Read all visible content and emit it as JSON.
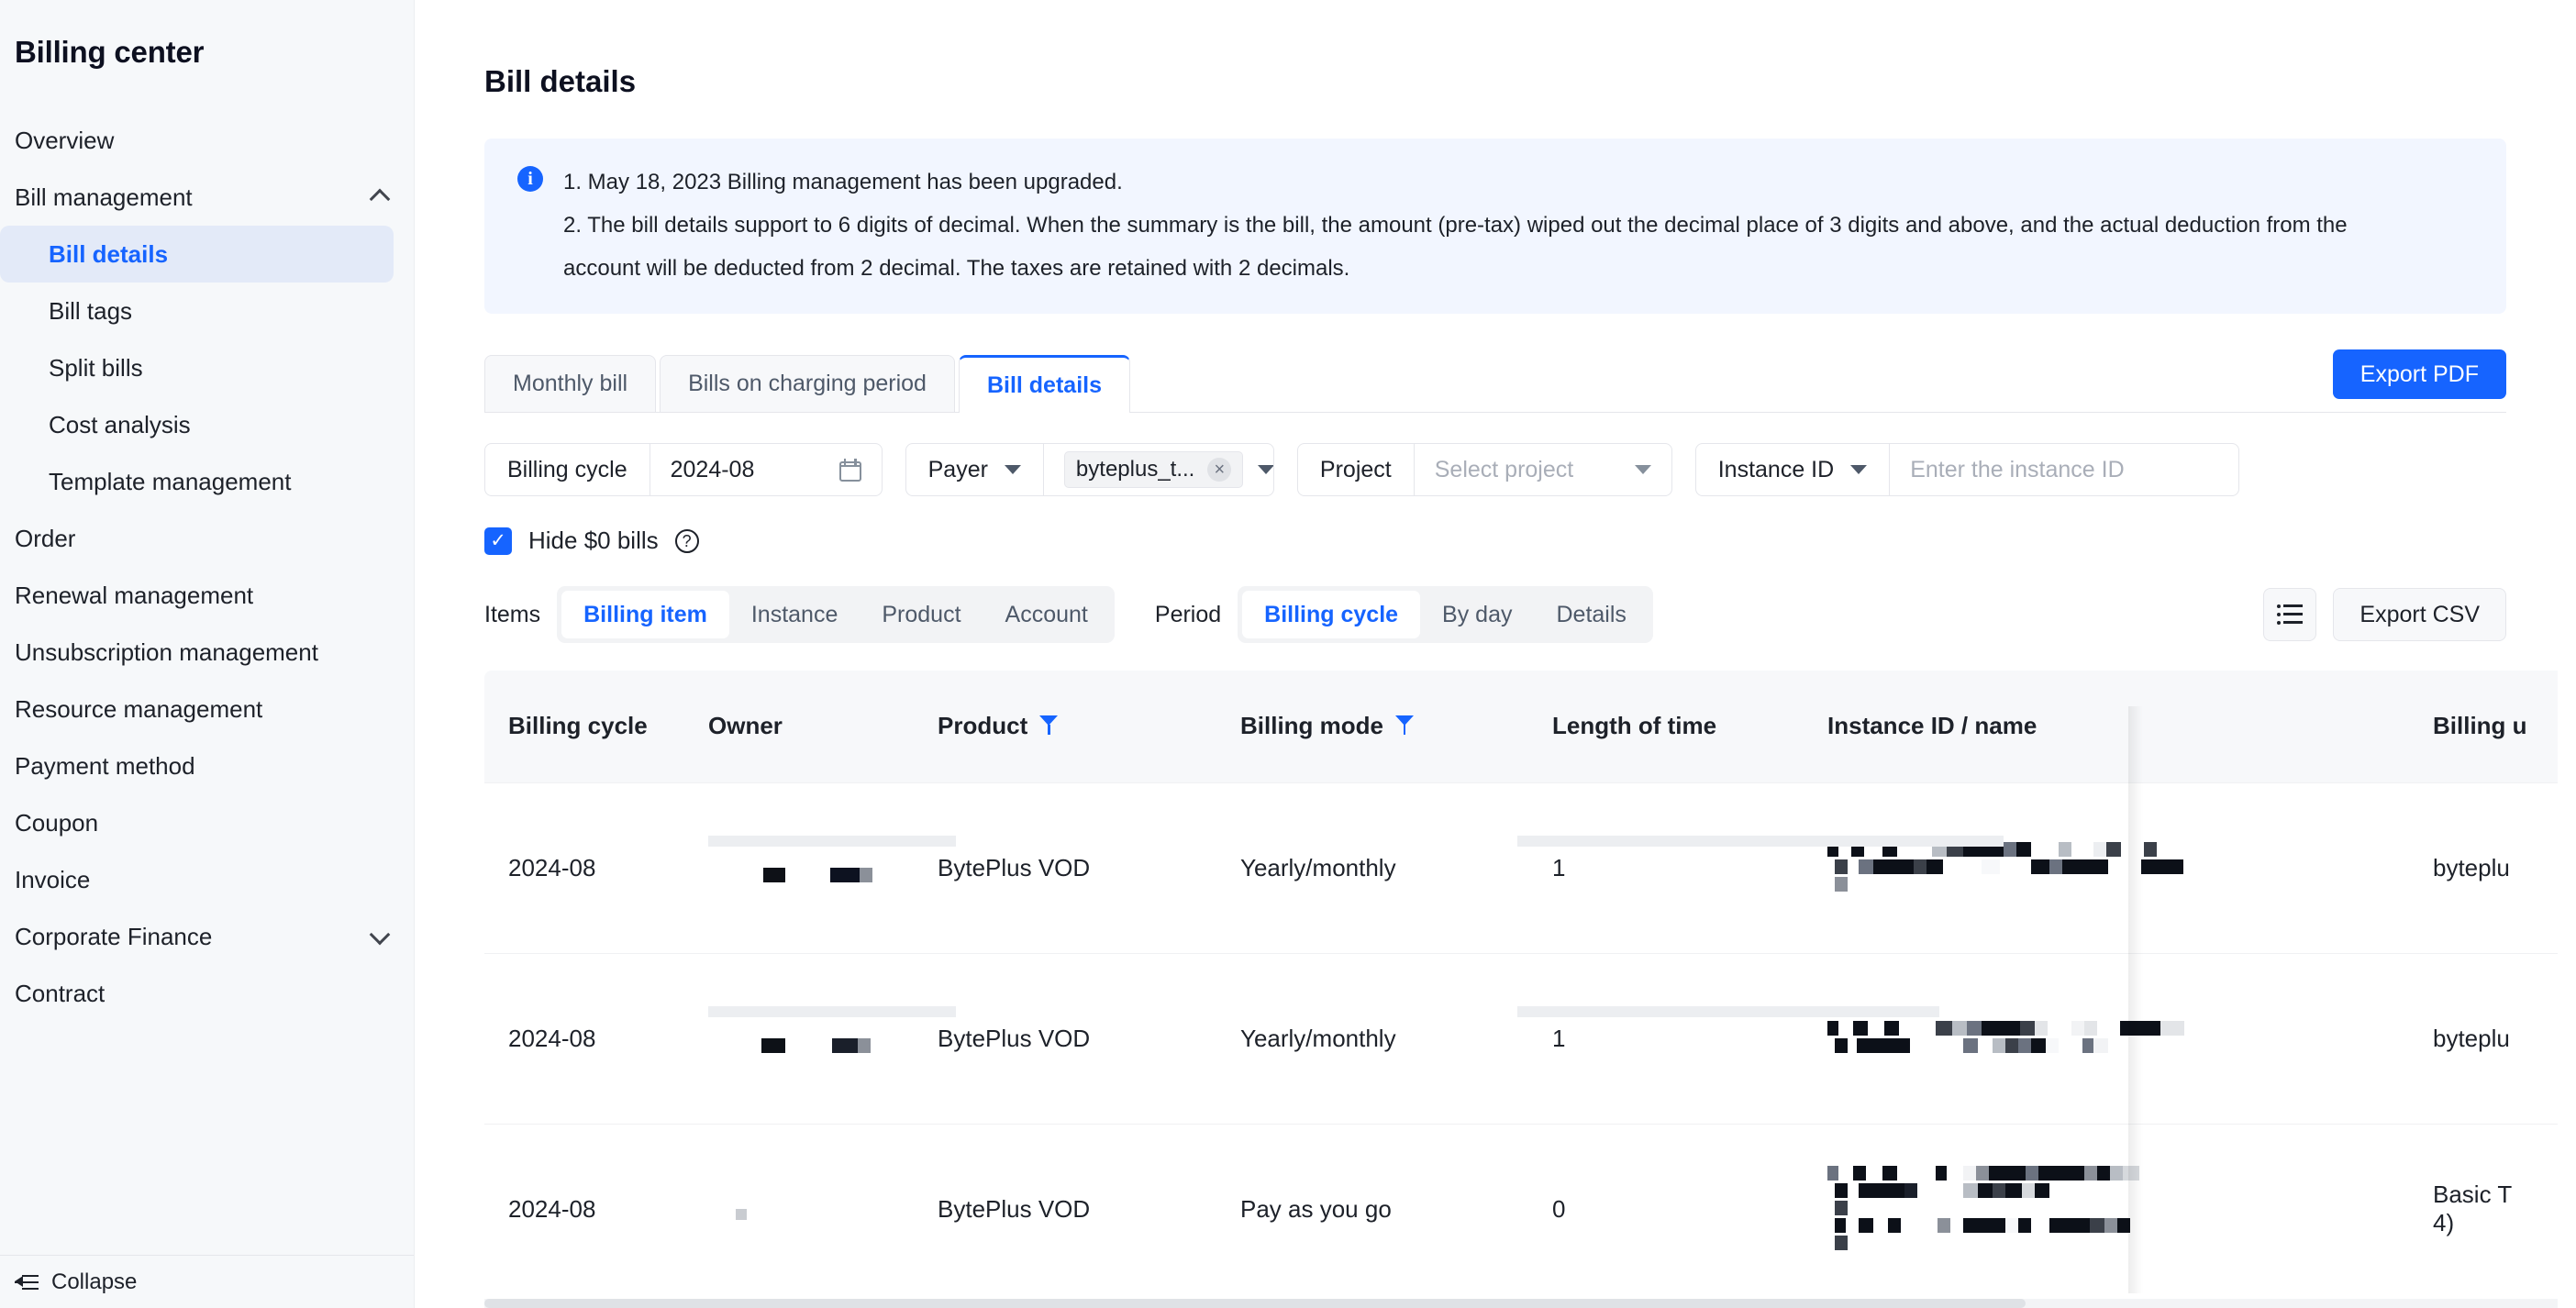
{
  "sidebar": {
    "title": "Billing center",
    "items": [
      {
        "label": "Overview",
        "type": "item"
      },
      {
        "label": "Bill management",
        "type": "group",
        "icon": "chevron-up-icon",
        "expanded": true
      },
      {
        "label": "Bill details",
        "type": "sub",
        "active": true
      },
      {
        "label": "Bill tags",
        "type": "sub"
      },
      {
        "label": "Split bills",
        "type": "sub"
      },
      {
        "label": "Cost analysis",
        "type": "sub"
      },
      {
        "label": "Template management",
        "type": "sub"
      },
      {
        "label": "Order",
        "type": "item"
      },
      {
        "label": "Renewal management",
        "type": "item"
      },
      {
        "label": "Unsubscription management",
        "type": "item"
      },
      {
        "label": "Resource management",
        "type": "item"
      },
      {
        "label": "Payment method",
        "type": "item"
      },
      {
        "label": "Coupon",
        "type": "item"
      },
      {
        "label": "Invoice",
        "type": "item"
      },
      {
        "label": "Corporate Finance",
        "type": "group",
        "icon": "chevron-down-icon",
        "expanded": false
      },
      {
        "label": "Contract",
        "type": "item"
      }
    ],
    "collapse_label": "Collapse"
  },
  "page": {
    "title": "Bill details"
  },
  "banner": {
    "icon": "info-icon",
    "line1": "1. May 18, 2023 Billing management has been upgraded.",
    "line2": "2. The bill details support to 6 digits of decimal. When the summary is the bill, the amount (pre-tax) wiped out the decimal place of 3 digits and above, and the actual deduction from the",
    "line3": "account will be deducted from 2 decimal. The taxes are retained with 2 decimals."
  },
  "tabs": [
    {
      "label": "Monthly bill",
      "active": false
    },
    {
      "label": "Bills on charging period",
      "active": false
    },
    {
      "label": "Bill details",
      "active": true
    }
  ],
  "toolbar": {
    "export_pdf_label": "Export PDF",
    "export_csv_label": "Export CSV",
    "list_view_icon": "list-icon"
  },
  "filters": {
    "billing_cycle": {
      "label": "Billing cycle",
      "value": "2024-08",
      "icon": "calendar-icon"
    },
    "payer": {
      "label": "Payer",
      "tag": "byteplus_t...",
      "remove_icon": "close-icon",
      "dropdown_icon": "chevron-down-icon"
    },
    "project": {
      "label": "Project",
      "placeholder": "Select project",
      "dropdown_icon": "chevron-down-icon"
    },
    "instance": {
      "label": "Instance ID",
      "placeholder": "Enter the instance ID",
      "dropdown_icon": "chevron-down-icon"
    },
    "hide_zero": {
      "label": "Hide $0 bills",
      "checked": true,
      "help_icon": "question-circle-icon"
    }
  },
  "segments": {
    "items_label": "Items",
    "items": [
      {
        "label": "Billing item",
        "active": true
      },
      {
        "label": "Instance",
        "active": false
      },
      {
        "label": "Product",
        "active": false
      },
      {
        "label": "Account",
        "active": false
      }
    ],
    "period_label": "Period",
    "period": [
      {
        "label": "Billing cycle",
        "active": true
      },
      {
        "label": "By day",
        "active": false
      },
      {
        "label": "Details",
        "active": false
      }
    ]
  },
  "table": {
    "columns": [
      {
        "label": "Billing cycle",
        "filter": false
      },
      {
        "label": "Owner",
        "filter": false
      },
      {
        "label": "Product",
        "filter": true
      },
      {
        "label": "Billing mode",
        "filter": true
      },
      {
        "label": "Length of time",
        "filter": false
      },
      {
        "label": "Instance ID / name",
        "filter": false
      },
      {
        "label": "Billing u",
        "filter": false
      }
    ],
    "rows": [
      {
        "billing_cycle": "2024-08",
        "owner": "[redacted]",
        "product": "BytePlus VOD",
        "billing_mode": "Yearly/monthly",
        "length_of_time": "1",
        "instance": "[redacted]",
        "billing_unit": "byteplu"
      },
      {
        "billing_cycle": "2024-08",
        "owner": "[redacted]",
        "product": "BytePlus VOD",
        "billing_mode": "Yearly/monthly",
        "length_of_time": "1",
        "instance": "[redacted]",
        "billing_unit": "byteplu"
      },
      {
        "billing_cycle": "2024-08",
        "owner": "[redacted]",
        "product": "BytePlus VOD",
        "billing_mode": "Pay as you go",
        "length_of_time": "0",
        "instance": "[redacted]",
        "billing_unit": "Basic T\n4)"
      }
    ]
  },
  "colors": {
    "accent": "#1664ff",
    "sidebar_bg": "#f6f8fa",
    "banner_bg": "#f2f6ff",
    "text": "#1d2129",
    "muted": "#86909c",
    "border": "#e5e6eb"
  }
}
